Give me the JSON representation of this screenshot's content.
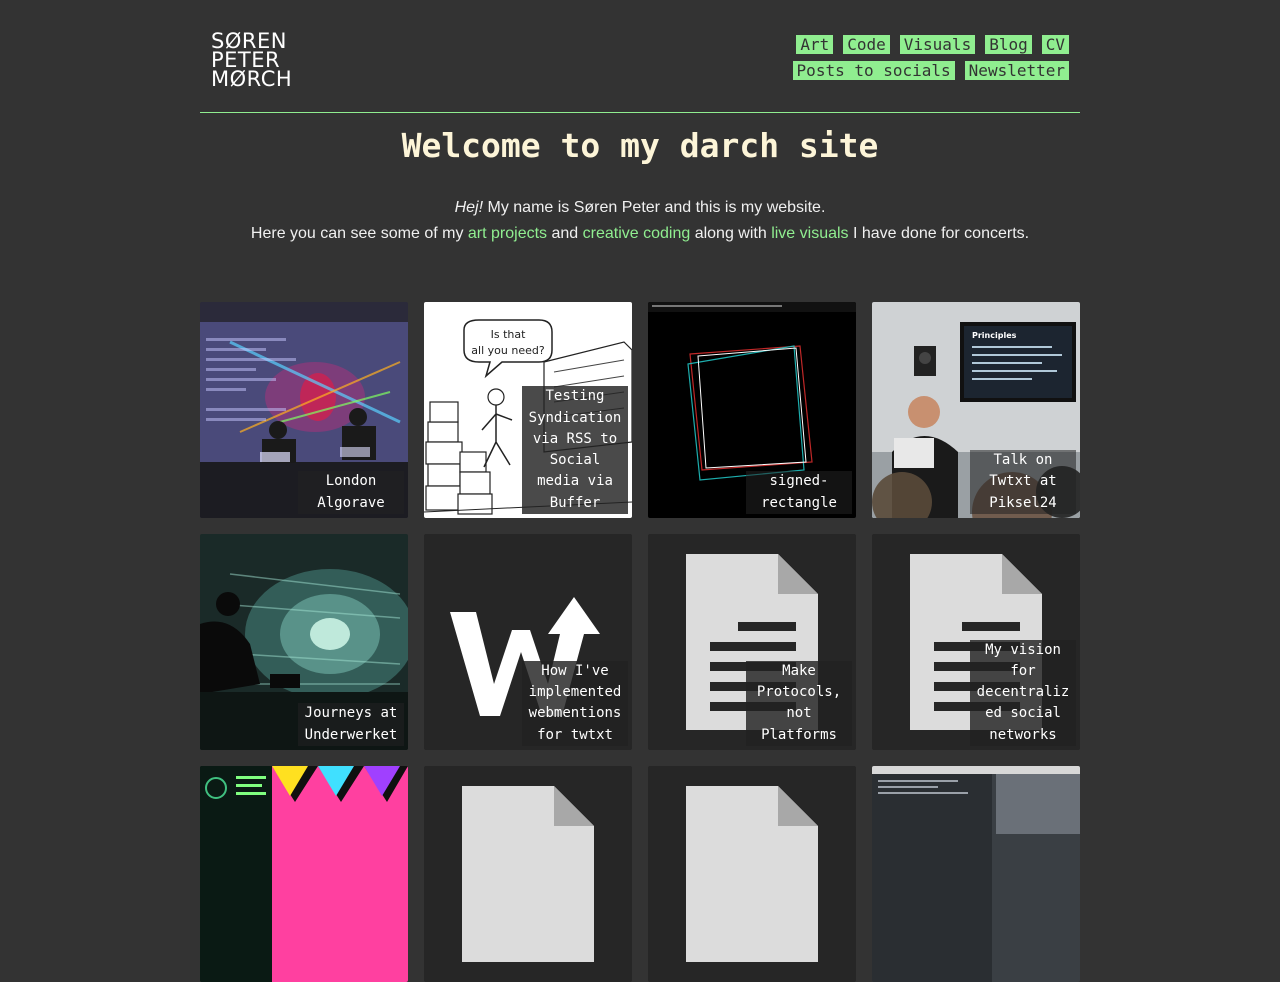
{
  "site": {
    "logo_lines": [
      "SØREN",
      "PETER",
      "MØRCH"
    ]
  },
  "nav": {
    "row1": [
      "Art",
      "Code",
      "Visuals",
      "Blog",
      "CV"
    ],
    "row2": [
      "Posts to socials",
      "Newsletter"
    ]
  },
  "page": {
    "title": "Welcome to my darch site"
  },
  "intro": {
    "greeting": "Hej!",
    "line1_rest": " My name is Søren Peter and this is my website.",
    "line2_a": "Here you can see some of my ",
    "link_art": "art projects",
    "line2_b": " and ",
    "link_code": "creative coding",
    "line2_c": " along with ",
    "link_visuals": "live visuals",
    "line2_d": " I have done for concerts."
  },
  "cards": [
    {
      "caption": "London Algorave",
      "icon": "algorave-photo"
    },
    {
      "caption": "Testing Syndication via RSS to Social media via Buffer",
      "icon": "comic-illustration"
    },
    {
      "caption": "signed-rectangle",
      "icon": "rectangle-art"
    },
    {
      "caption": "Talk on Twtxt at Piksel24",
      "icon": "talk-photo"
    },
    {
      "caption": "Journeys at Underwerket",
      "icon": "performance-photo"
    },
    {
      "caption": "How I've implemented webmentions for twtxt",
      "icon": "webmention-logo"
    },
    {
      "caption": "Make Protocols, not Platforms",
      "icon": "document-icon"
    },
    {
      "caption": "My vision for decentralized social networks",
      "icon": "document-icon"
    }
  ],
  "colors": {
    "background": "#333333",
    "accent": "#90ee90",
    "title": "#fdf5d8"
  }
}
